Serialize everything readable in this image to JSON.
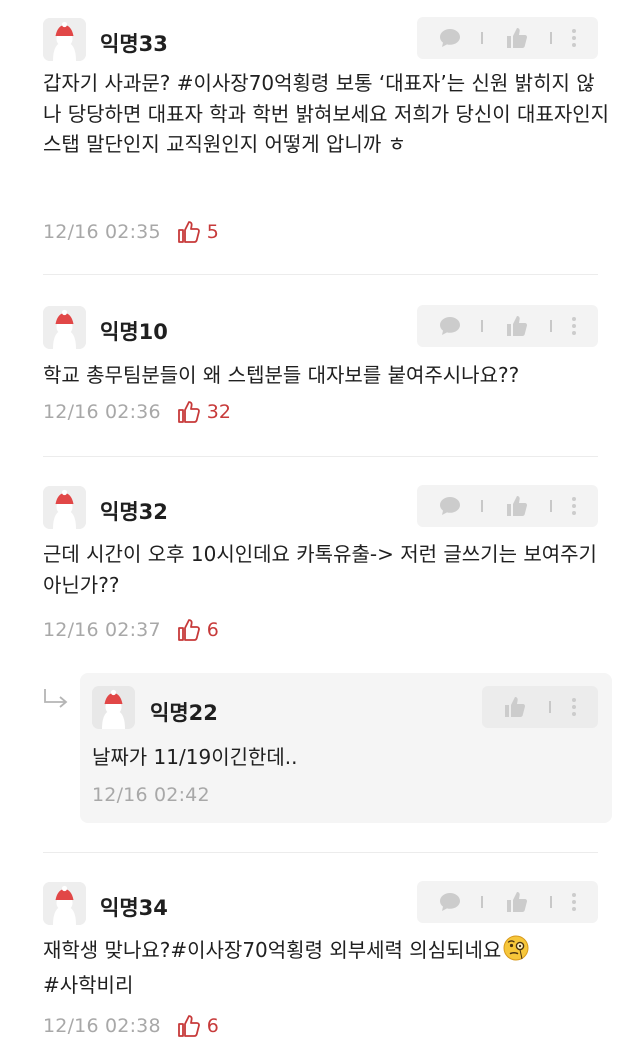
{
  "comments": [
    {
      "nickname": "익명33",
      "text": "갑자기 사과문? #이사장70억횡령 보통 ‘대표자’는 신원 밝히지 않나 당당하면 대표자 학과 학번 밝혀보세요 저희가 당신이 대표자인지 스탭 말단인지 교직원인지 어떻게 압니까 ㅎ",
      "date": "12/16 02:35",
      "likes": "5"
    },
    {
      "nickname": "익명10",
      "text": "학교 총무팀분들이 왜 스텝분들 대자보를 붙여주시나요??",
      "date": "12/16 02:36",
      "likes": "32"
    },
    {
      "nickname": "익명32",
      "text": "근데 시간이 오후 10시인데요 카톡유출-> 저런 글쓰기는 보여주기 아닌가??",
      "date": "12/16 02:37",
      "likes": "6"
    },
    {
      "nickname": "익명34",
      "text": "재학생 맞나요?#이사장70억횡령 외부세력 의심되네요",
      "text2": "#사학비리",
      "date": "12/16 02:38",
      "likes": "6"
    }
  ],
  "reply": {
    "nickname": "익명22",
    "text": "날짜가 11/19이긴한데..",
    "date": "12/16 02:42"
  },
  "icons": {
    "comment": "speech-bubble-icon",
    "like": "thumbs-up-icon",
    "more": "more-vertical-icon",
    "reply": "reply-arrow-icon",
    "emoji": "face-with-monocle-emoji"
  },
  "colors": {
    "like_accent": "#c73a3a",
    "meta_gray": "#a8a8a8",
    "toolbar_bg": "#f3f3f3"
  }
}
